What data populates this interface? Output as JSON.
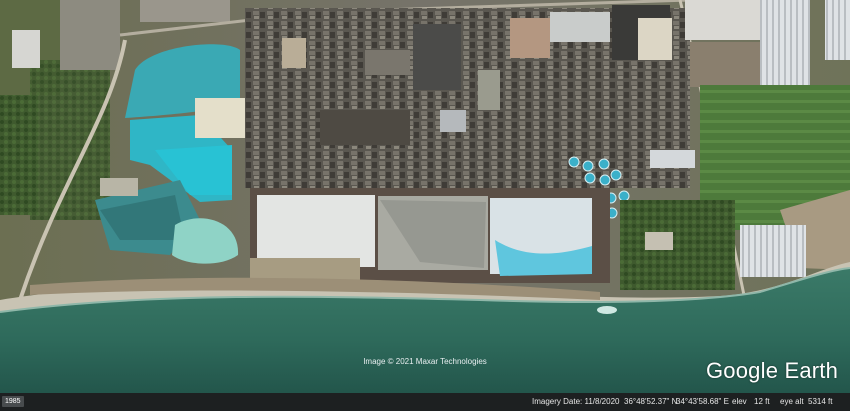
{
  "overlay": {
    "copyright": "Image © 2021 Maxar Technologies",
    "logo": "Google Earth"
  },
  "status_bar": {
    "year_badge": "1985",
    "imagery_date": "Imagery Date: 11/8/2020",
    "latitude": "36°48'52.37\" N",
    "longitude": "34°43'58.68\" E",
    "elev_label": "elev",
    "elev_value": "12 ft",
    "eye_alt_label": "eye alt",
    "eye_alt_value": "5314 ft"
  },
  "colors": {
    "sea": "#2e6a5c",
    "shore": "#c4c0b0",
    "industrial": "#5f5c55",
    "pond_cyan": "#3fb2c0",
    "salt_white": "#e1e3e1",
    "farmland": "#4f7a3c",
    "status_bg": "#1d2021"
  }
}
